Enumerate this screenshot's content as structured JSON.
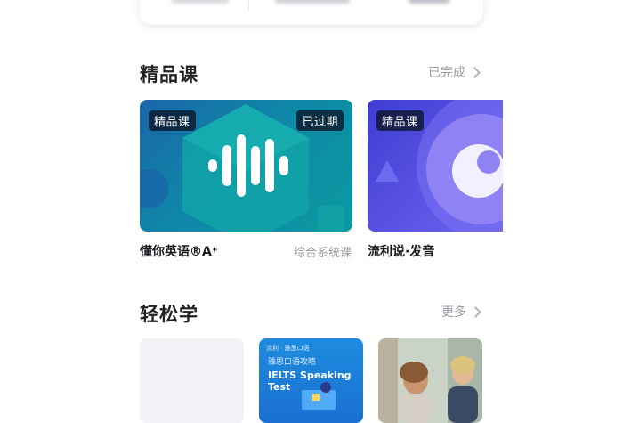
{
  "premium": {
    "title": "精品课",
    "link": "已完成",
    "courses": [
      {
        "tag": "精品课",
        "status": "已过期",
        "name": "懂你英语®A⁺",
        "category": "综合系统课"
      },
      {
        "tag": "精品课",
        "name": "流利说·发音"
      }
    ]
  },
  "easy": {
    "title": "轻松学",
    "link": "更多",
    "thumbs": [
      {
        "brand": "流利 · 雅思口语",
        "subtitle": "雅思口语攻略",
        "title": "IELTS Speaking Test"
      }
    ]
  },
  "colors": {
    "teal_card": "#0f87a8",
    "purple_card": "#5b54e6",
    "tag_bg": "#14203a"
  }
}
